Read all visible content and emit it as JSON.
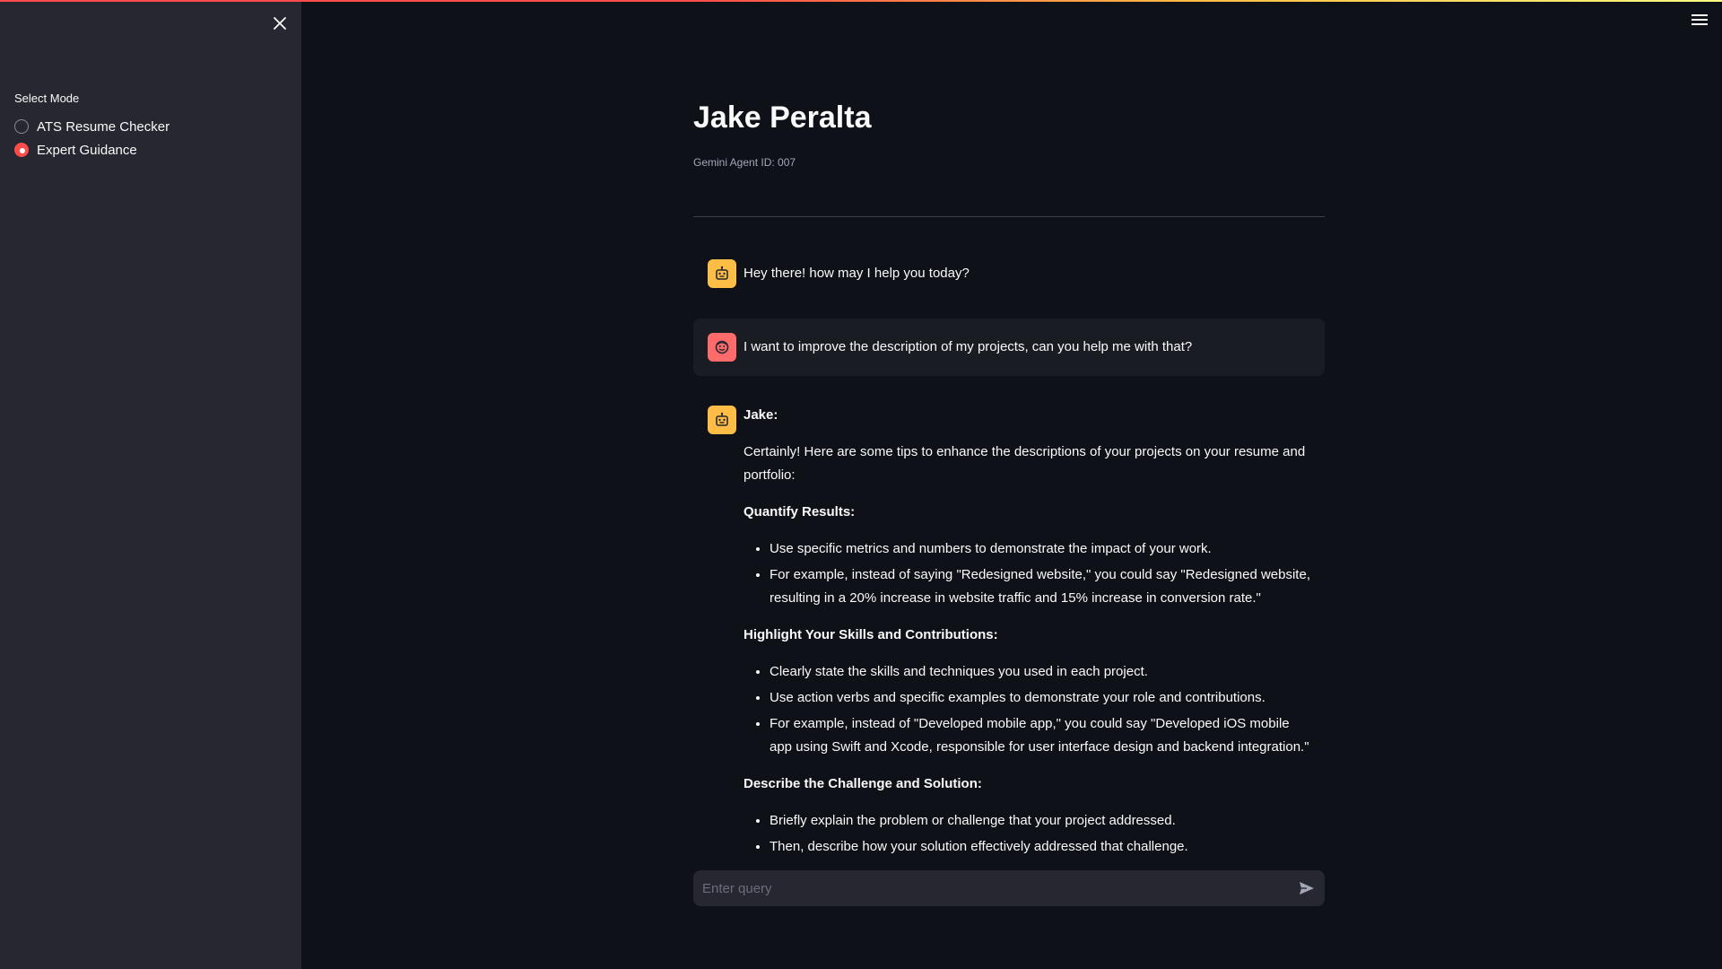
{
  "sidebar": {
    "close_icon": "close-icon",
    "mode_label": "Select Mode",
    "options": [
      {
        "label": "ATS Resume Checker",
        "selected": false
      },
      {
        "label": "Expert Guidance",
        "selected": true
      }
    ]
  },
  "header": {
    "menu_icon": "hamburger-menu-icon"
  },
  "main": {
    "title": "Jake Peralta",
    "caption": "Gemini Agent ID: 007"
  },
  "chat": {
    "messages": [
      {
        "role": "assistant",
        "avatar": "robot-icon",
        "text": "Hey there! how may I help you today?"
      },
      {
        "role": "user",
        "avatar": "user-face-icon",
        "text": "I want to improve the description of my projects, can you help me with that?"
      },
      {
        "role": "assistant",
        "avatar": "robot-icon",
        "speaker": "Jake:",
        "intro": "Certainly! Here are some tips to enhance the descriptions of your projects on your resume and portfolio:",
        "sections": [
          {
            "heading": "Quantify Results:",
            "bullets": [
              "Use specific metrics and numbers to demonstrate the impact of your work.",
              "For example, instead of saying \"Redesigned website,\" you could say \"Redesigned website, resulting in a 20% increase in website traffic and 15% increase in conversion rate.\""
            ]
          },
          {
            "heading": "Highlight Your Skills and Contributions:",
            "bullets": [
              "Clearly state the skills and techniques you used in each project.",
              "Use action verbs and specific examples to demonstrate your role and contributions.",
              "For example, instead of \"Developed mobile app,\" you could say \"Developed iOS mobile app using Swift and Xcode, responsible for user interface design and backend integration.\""
            ]
          },
          {
            "heading": "Describe the Challenge and Solution:",
            "bullets": [
              "Briefly explain the problem or challenge that your project addressed.",
              "Then, describe how your solution effectively addressed that challenge."
            ]
          }
        ]
      }
    ],
    "input_placeholder": "Enter query",
    "send_icon": "send-icon"
  },
  "colors": {
    "background": "#0e1117",
    "sidebar": "#262730",
    "accent": "#ff4b4b",
    "bot_avatar": "#ffbd45",
    "user_avatar": "#ff6b6b"
  }
}
